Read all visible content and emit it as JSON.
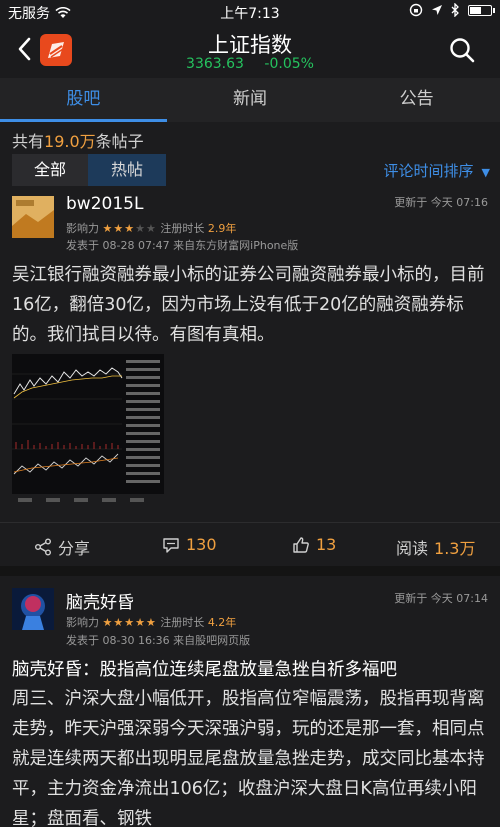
{
  "status_bar": {
    "carrier": "无服务",
    "time": "上午7:13",
    "battery_level": 0.6
  },
  "header": {
    "title": "上证指数",
    "price": "3363.63",
    "change": "-0.05%"
  },
  "tabs": [
    {
      "label": "股吧",
      "active": true
    },
    {
      "label": "新闻",
      "active": false
    },
    {
      "label": "公告",
      "active": false
    }
  ],
  "summary": {
    "prefix": "共有",
    "count": "19.0万",
    "suffix": "条帖子"
  },
  "filter": {
    "all": "全部",
    "hot": "热帖",
    "sort": "评论时间排序"
  },
  "posts": [
    {
      "author": "bw2015L",
      "influence_label": "影响力",
      "stars": "★★★",
      "empty_stars": "★★",
      "registered_label": "注册时长",
      "registered": "2.9年",
      "updated": "更新于 今天 07:16",
      "posted": "发表于 08-28 07:47  来自东方财富网iPhone版",
      "body": "吴江银行融资融券最小标的证券公司融资融券最小标的，目前16亿，翻倍30亿，因为市场上没有低于20亿的融资融券标的。我们拭目以待。有图有真相。",
      "share": "分享",
      "comments": "130",
      "likes": "13",
      "read_label": "阅读",
      "reads": "1.3万"
    },
    {
      "author": "脑壳好昏",
      "influence_label": "影响力",
      "stars": "★★★★★",
      "registered_label": "注册时长",
      "registered": "4.2年",
      "updated": "更新于 今天 07:14",
      "posted": "发表于 08-30 16:36  来自股吧网页版",
      "title": "脑壳好昏：股指高位连续尾盘放量急挫自祈多福吧",
      "body": "周三、沪深大盘小幅低开，股指高位窄幅震荡，股指再现背离走势，昨天沪强深弱今天深强沪弱，玩的还是那一套，相同点就是连续两天都出现明显尾盘放量急挫走势，成交同比基本持平，主力资金净流出106亿；收盘沪深大盘日K高位再续小阳星；盘面看、钢铁"
    }
  ],
  "colors": {
    "accent": "#3e8ee6",
    "orange": "#f0a040",
    "green": "#25c25e",
    "background": "#1c1c1e"
  }
}
